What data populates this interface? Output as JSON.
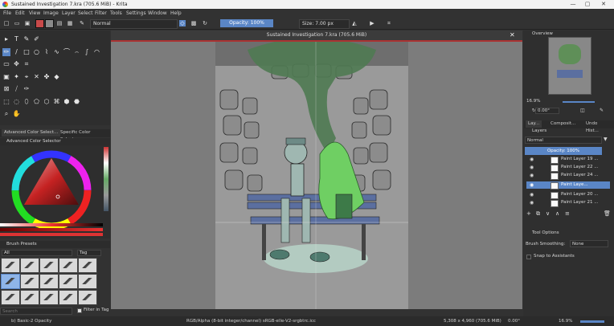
{
  "window": {
    "title": "Sustained Investigation 7.kra (705.6 MiB) - Krita",
    "minimize": "—",
    "restore": "▢",
    "close": "✕"
  },
  "menu": [
    "File",
    "Edit",
    "View",
    "Image",
    "Layer",
    "Select",
    "Filter",
    "Tools",
    "Settings",
    "Window",
    "Help"
  ],
  "toolbar": {
    "blend_mode": "Normal",
    "opacity": "Opacity: 100%",
    "size": "Size: 7.00 px"
  },
  "document": {
    "title": "Sustained Investigation 7.kra (705.6 MiB)",
    "close": "✕"
  },
  "left_dock": {
    "color_tabs": [
      "Advanced Color Select...",
      "Specific Color Selector"
    ],
    "color_panel_title": "Advanced Color Selector",
    "brush_panel_title": "Brush Presets",
    "brush_filter": "All",
    "brush_tag": "Tag",
    "search_placeholder": "Search",
    "filter_in_tag": "Filter in Tag"
  },
  "right_dock": {
    "overview_title": "Overview",
    "zoom": "16.9%",
    "rotation": "0.00°",
    "tabs": [
      "Lay...",
      "Composit...",
      "Undo Hist..."
    ],
    "layers_title": "Layers",
    "layer_blend": "Normal",
    "layer_opacity": "Opacity: 100%",
    "layers": [
      {
        "name": "Paint Layer 19 ..."
      },
      {
        "name": "Paint Layer 22 ..."
      },
      {
        "name": "Paint Layer 24 ..."
      },
      {
        "name": "Paint Laye...",
        "selected": true
      },
      {
        "name": "Paint Layer 20 ..."
      },
      {
        "name": "Paint Layer 21 ..."
      }
    ],
    "tool_options_title": "Tool Options",
    "brush_smoothing_label": "Brush Smoothing:",
    "brush_smoothing_value": "None",
    "snap_label": "Snap to Assistants"
  },
  "status": {
    "brush": "b) Basic-2 Opacity",
    "color": "RGB/Alpha (8-bit integer/channel)  sRGB-elle-V2-srgbtrc.icc",
    "dimensions": "5,308 x 4,960 (705.6 MiB)",
    "rotation": "0.00°",
    "zoom": "16.9%"
  },
  "colors": {
    "accent": "#5a86c6",
    "bg": "#323232",
    "canvas_bg": "#7c7c7c"
  }
}
